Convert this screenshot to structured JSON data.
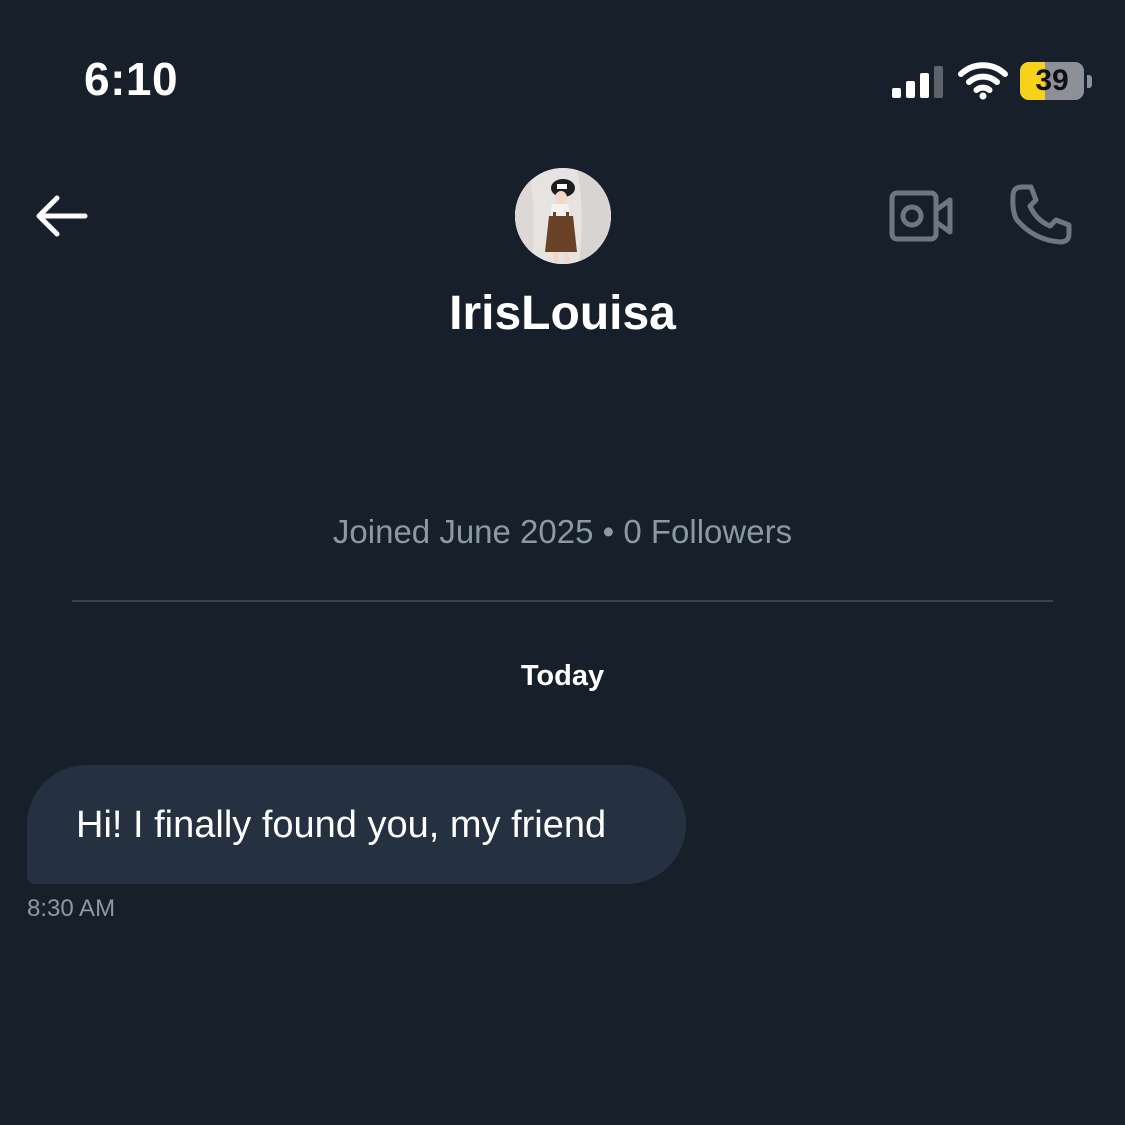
{
  "status_bar": {
    "time": "6:10",
    "battery_level": "39",
    "battery_fraction": 0.39,
    "signal_bars_filled": 3,
    "signal_bars_total": 4,
    "battery_color": "#f7d21a"
  },
  "header": {
    "back_icon": "arrow-left-icon",
    "name": "IrisLouisa",
    "video_icon": "video-camera-icon",
    "phone_icon": "phone-icon"
  },
  "profile": {
    "meta": "Joined June 2025 • 0 Followers"
  },
  "conversation": {
    "date_label": "Today",
    "messages": [
      {
        "text": "Hi! I finally found you, my friend",
        "time": "8:30 AM"
      }
    ]
  },
  "colors": {
    "background": "#171f2a",
    "bubble": "#253140",
    "muted_text": "#8b98a5",
    "icon_gray": "#6e7781"
  }
}
